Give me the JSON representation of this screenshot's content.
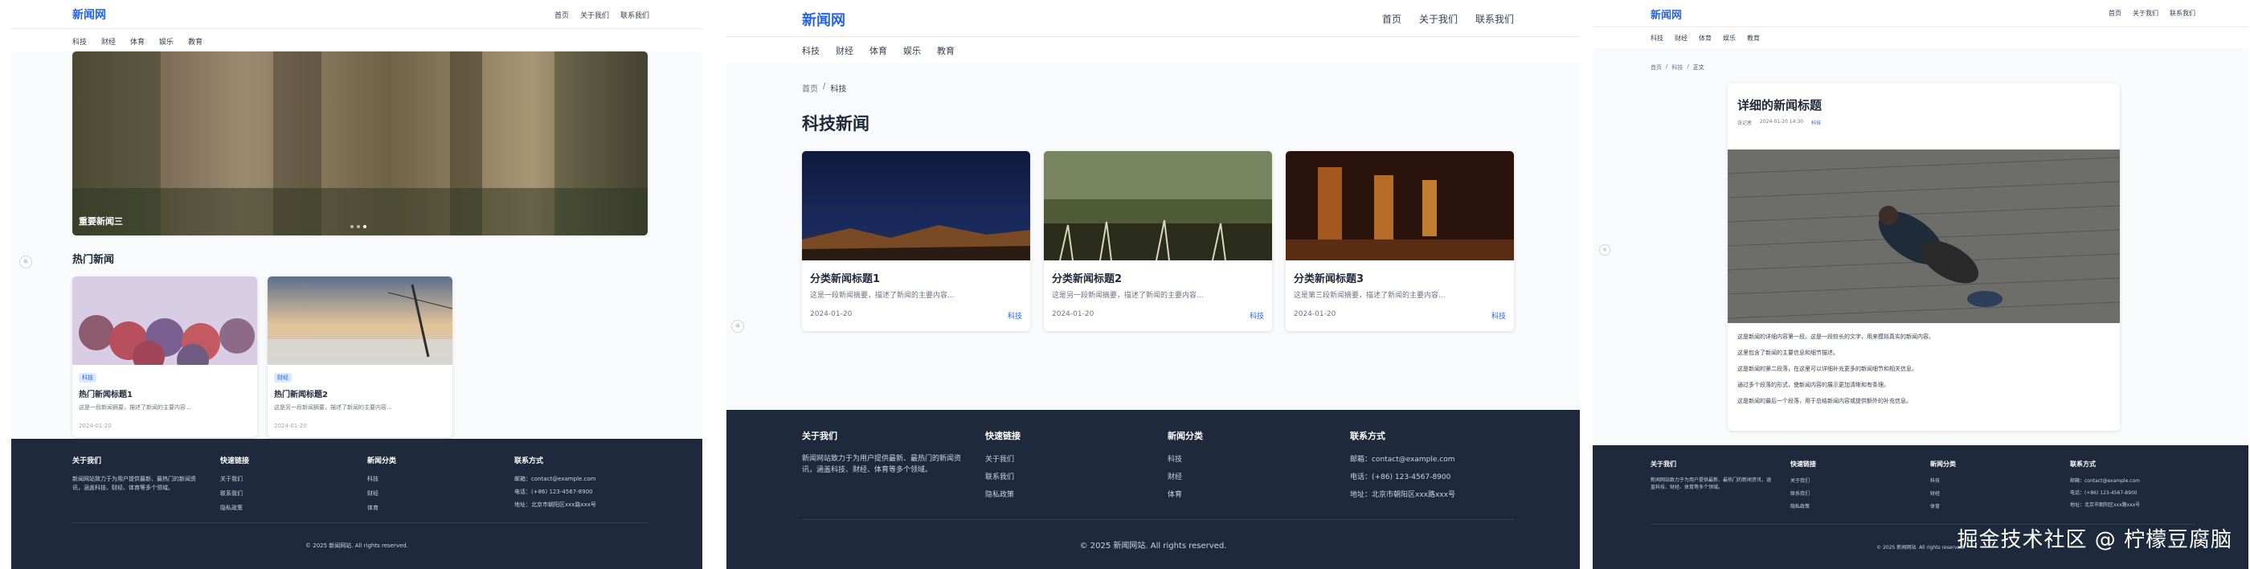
{
  "site": {
    "logo": "新闻网",
    "top_nav": [
      "首页",
      "关于我们",
      "联系我们"
    ],
    "categories": [
      "科技",
      "财经",
      "体育",
      "娱乐",
      "教育"
    ]
  },
  "home": {
    "carousel_caption": "重要新闻三",
    "carousel_dots": 3,
    "carousel_active_dot": 3,
    "hot_title": "热门新闻",
    "hot_cards": [
      {
        "tag": "科技",
        "title": "热门新闻标题1",
        "desc": "这是一段新闻摘要，描述了新闻的主要内容...",
        "date": "2024-01-20"
      },
      {
        "tag": "财经",
        "title": "热门新闻标题2",
        "desc": "这是另一段新闻摘要，描述了新闻的主要内容...",
        "date": "2024-01-20"
      }
    ]
  },
  "category_page": {
    "breadcrumb": [
      "首页",
      "科技"
    ],
    "heading": "科技新闻",
    "cards": [
      {
        "title": "分类新闻标题1",
        "desc": "这是一段新闻摘要，描述了新闻的主要内容...",
        "date": "2024-01-20",
        "tag": "科技"
      },
      {
        "title": "分类新闻标题2",
        "desc": "这是另一段新闻摘要，描述了新闻的主要内容...",
        "date": "2024-01-20",
        "tag": "科技"
      },
      {
        "title": "分类新闻标题3",
        "desc": "这是第三段新闻摘要，描述了新闻的主要内容...",
        "date": "2024-01-20",
        "tag": "科技"
      }
    ]
  },
  "detail_page": {
    "breadcrumb": [
      "首页",
      "科技",
      "正文"
    ],
    "title": "详细的新闻标题",
    "author": "张记者",
    "datetime": "2024-01-20 14:30",
    "tag": "科技",
    "paragraphs": [
      "这是新闻的详细内容第一段。这是一段较长的文字，用来模拟真实的新闻内容。",
      "这里包含了新闻的主要信息和细节描述。",
      "这是新闻的第二段落，在这里可以详细补充更多的新闻细节和相关信息。",
      "通过多个段落的形式，使新闻内容的展示更加清晰和有条理。",
      "这是新闻的最后一个段落，用于总结新闻内容或提供额外的补充信息。"
    ]
  },
  "footer": {
    "about_title": "关于我们",
    "about_text": "新闻网站致力于为用户提供最新、最热门的新闻资讯，涵盖科技、财经、体育等多个领域。",
    "links_title": "快速链接",
    "links": [
      "关于我们",
      "联系我们",
      "隐私政策"
    ],
    "cats_title": "新闻分类",
    "cats": [
      "科技",
      "财经",
      "体育"
    ],
    "contact_title": "联系方式",
    "contact": [
      "邮箱：contact@example.com",
      "电话：(+86) 123-4567-8900",
      "地址：北京市朝阳区xxx路xxx号"
    ],
    "copyright": "© 2025 新闻网站. All rights reserved."
  },
  "watermark": "掘金技术社区 @ 柠檬豆腐脑",
  "colors": {
    "accent": "#2563eb",
    "footer_bg": "#1e293b",
    "page_bg": "#f9fafb",
    "badge_bg": "#dbeafe"
  }
}
